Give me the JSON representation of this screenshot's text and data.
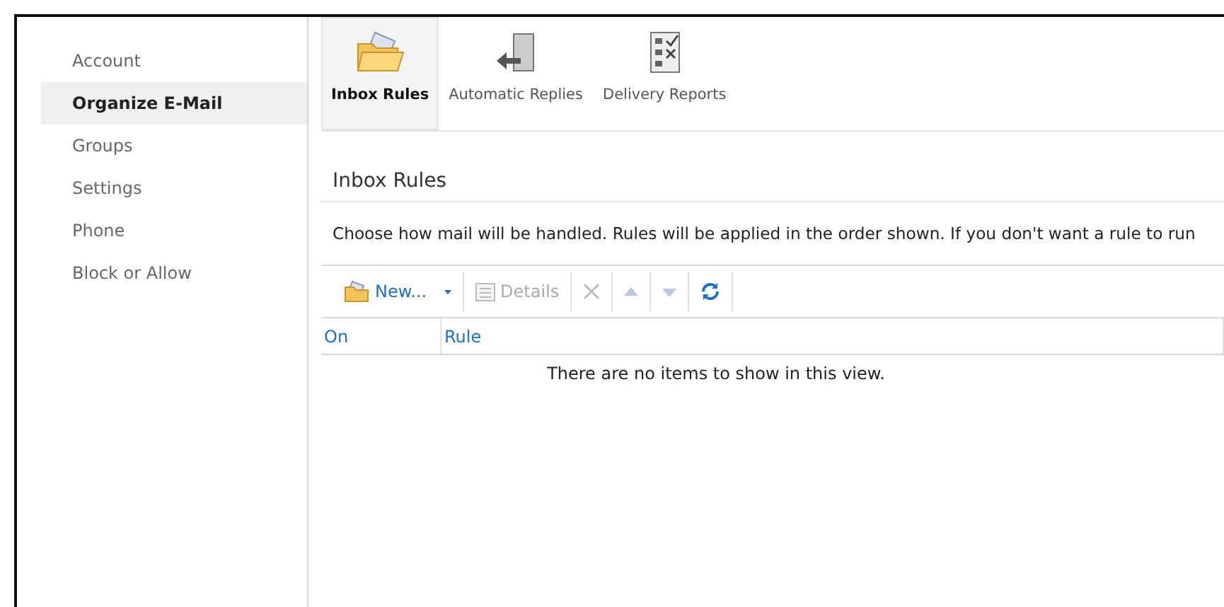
{
  "sidebar": {
    "items": [
      {
        "label": "Account",
        "selected": false
      },
      {
        "label": "Organize E-Mail",
        "selected": true
      },
      {
        "label": "Groups",
        "selected": false
      },
      {
        "label": "Settings",
        "selected": false
      },
      {
        "label": "Phone",
        "selected": false
      },
      {
        "label": "Block or Allow",
        "selected": false
      }
    ]
  },
  "ribbon": {
    "tabs": [
      {
        "label": "Inbox Rules",
        "selected": true,
        "kind": "folder"
      },
      {
        "label": "Automatic Replies",
        "selected": false,
        "kind": "door"
      },
      {
        "label": "Delivery Reports",
        "selected": false,
        "kind": "checklist"
      }
    ]
  },
  "section": {
    "title": "Inbox Rules",
    "description": "Choose how mail will be handled. Rules will be applied in the order shown. If you don't want a rule to run"
  },
  "toolbar": [
    {
      "kind": "new",
      "label": "New...",
      "disabled": false
    },
    {
      "kind": "details",
      "label": "Details",
      "disabled": true
    },
    {
      "kind": "delete",
      "disabled": true
    },
    {
      "kind": "up",
      "disabled": true
    },
    {
      "kind": "down",
      "disabled": true
    },
    {
      "kind": "refresh",
      "disabled": false
    }
  ],
  "table": {
    "columns": [
      "On",
      "Rule"
    ],
    "empty_message": "There are no items to show in this view."
  }
}
